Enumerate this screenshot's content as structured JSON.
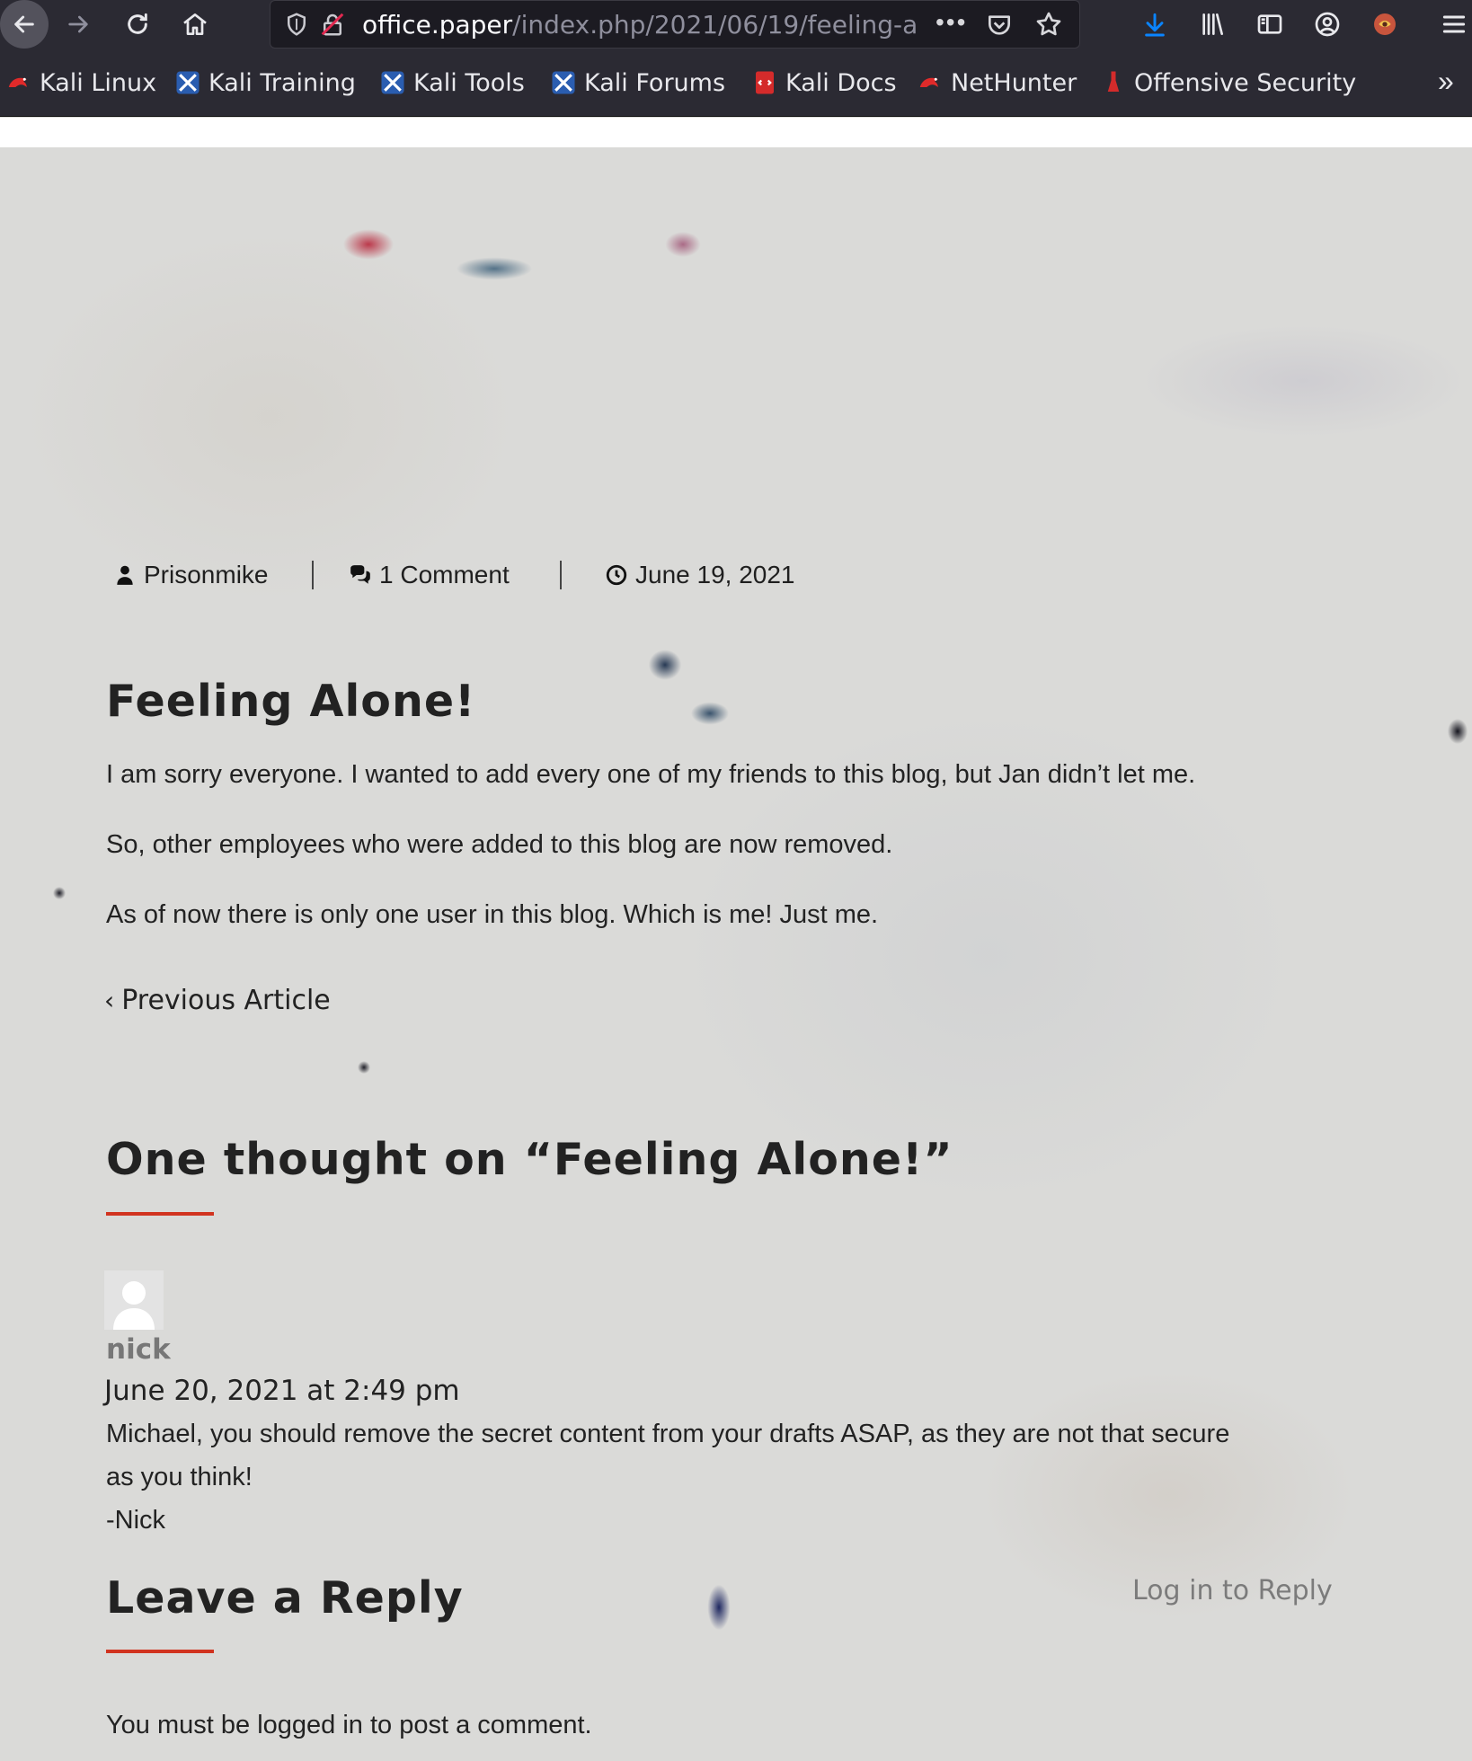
{
  "browser": {
    "url_host": "office.paper",
    "url_path": "/index.php/2021/06/19/feeling-a",
    "url_more": "•••",
    "bookmarks_overflow": "»",
    "bookmarks": [
      {
        "label": "Kali Linux",
        "icon": "kali-dragon-icon"
      },
      {
        "label": "Kali Training",
        "icon": "kali-tools-icon"
      },
      {
        "label": "Kali Tools",
        "icon": "kali-tools-icon"
      },
      {
        "label": "Kali Forums",
        "icon": "kali-tools-icon"
      },
      {
        "label": "Kali Docs",
        "icon": "kali-docs-icon"
      },
      {
        "label": "NetHunter",
        "icon": "kali-dragon-icon"
      },
      {
        "label": "Offensive Security",
        "icon": "offsec-icon"
      }
    ],
    "toolbar_icons": [
      "back-arrow-icon",
      "forward-arrow-icon",
      "reload-icon",
      "home-icon",
      "shield-icon",
      "insecure-lock-icon",
      "pocket-icon",
      "star-icon",
      "download-icon",
      "library-icon",
      "sidebar-icon",
      "account-icon",
      "extension-icon",
      "menu-icon"
    ],
    "accent_color": "#0a84ff"
  },
  "post": {
    "author": "Prisonmike",
    "comments": "1 Comment",
    "date": "June 19, 2021",
    "title": "Feeling Alone!",
    "paragraphs": [
      "I am sorry everyone. I wanted to add every one of my friends to this blog, but Jan didn’t let me.",
      "So, other employees who were added to this blog are now removed.",
      "As of now there is only one user in this blog. Which is me! Just me."
    ],
    "prev_article": "Previous Article"
  },
  "comments_section": {
    "heading": "One thought on “Feeling Alone!”",
    "accent_color": "#d1331f",
    "comment": {
      "author": "nick",
      "date": "June 20, 2021 at 2:49 pm",
      "lines": [
        "Michael, you should remove the secret content from your drafts ASAP, as they are not that secure",
        "as you think!",
        "-Nick"
      ]
    }
  },
  "reply": {
    "heading": "Leave a Reply",
    "login_link": "Log in to Reply",
    "notice": "You must be logged in to post a comment."
  }
}
